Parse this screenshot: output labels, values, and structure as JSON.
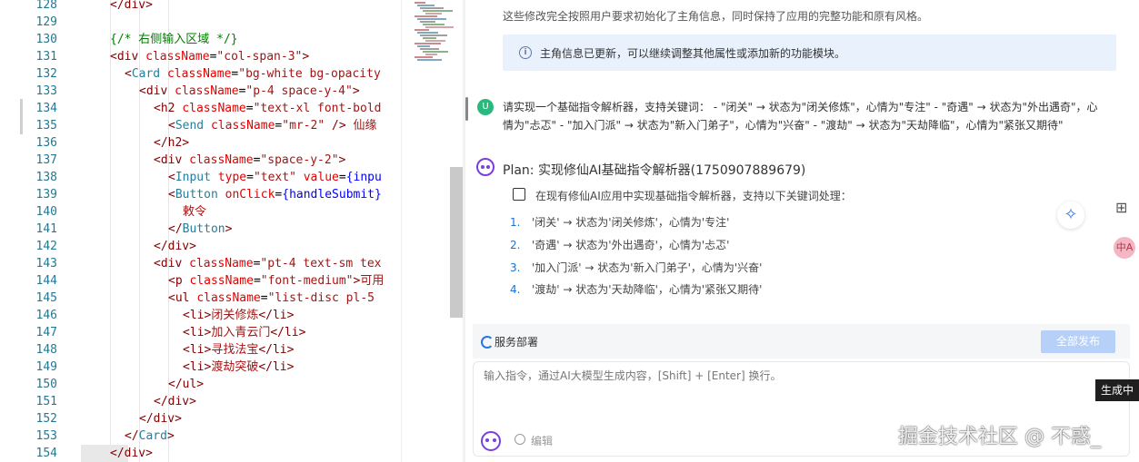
{
  "editor": {
    "lines": [
      {
        "n": "128",
        "indent": 4,
        "tokens": [
          [
            "t-tag",
            "</div>"
          ]
        ]
      },
      {
        "n": "129",
        "indent": 0,
        "tokens": []
      },
      {
        "n": "130",
        "indent": 4,
        "tokens": [
          [
            "t-com",
            "{/* 右侧输入区域 */}"
          ]
        ]
      },
      {
        "n": "131",
        "indent": 4,
        "tokens": [
          [
            "t-tag",
            "<div "
          ],
          [
            "t-attr",
            "className"
          ],
          [
            "t-txt",
            "="
          ],
          [
            "t-str",
            "\"col-span-3\""
          ],
          [
            "t-tag",
            ">"
          ]
        ]
      },
      {
        "n": "132",
        "indent": 6,
        "tokens": [
          [
            "t-tag",
            "<"
          ],
          [
            "t-comp",
            "Card"
          ],
          [
            "t-tag",
            " "
          ],
          [
            "t-attr",
            "className"
          ],
          [
            "t-txt",
            "="
          ],
          [
            "t-str",
            "\"bg-white bg-opacity"
          ]
        ]
      },
      {
        "n": "133",
        "indent": 8,
        "tokens": [
          [
            "t-tag",
            "<div "
          ],
          [
            "t-attr",
            "className"
          ],
          [
            "t-txt",
            "="
          ],
          [
            "t-str",
            "\"p-4 space-y-4\""
          ],
          [
            "t-tag",
            ">"
          ]
        ]
      },
      {
        "n": "134",
        "indent": 10,
        "tokens": [
          [
            "t-tag",
            "<h2 "
          ],
          [
            "t-attr",
            "className"
          ],
          [
            "t-txt",
            "="
          ],
          [
            "t-str",
            "\"text-xl font-bold"
          ]
        ]
      },
      {
        "n": "135",
        "indent": 12,
        "tokens": [
          [
            "t-tag",
            "<"
          ],
          [
            "t-comp",
            "Send"
          ],
          [
            "t-tag",
            " "
          ],
          [
            "t-attr",
            "className"
          ],
          [
            "t-txt",
            "="
          ],
          [
            "t-str",
            "\"mr-2\""
          ],
          [
            "t-tag",
            " /> "
          ],
          [
            "t-zh",
            "仙缘"
          ]
        ]
      },
      {
        "n": "136",
        "indent": 10,
        "tokens": [
          [
            "t-tag",
            "</h2>"
          ]
        ]
      },
      {
        "n": "137",
        "indent": 10,
        "tokens": [
          [
            "t-tag",
            "<div "
          ],
          [
            "t-attr",
            "className"
          ],
          [
            "t-txt",
            "="
          ],
          [
            "t-str",
            "\"space-y-2\""
          ],
          [
            "t-tag",
            ">"
          ]
        ]
      },
      {
        "n": "138",
        "indent": 12,
        "tokens": [
          [
            "t-tag",
            "<"
          ],
          [
            "t-comp",
            "Input"
          ],
          [
            "t-tag",
            " "
          ],
          [
            "t-attr",
            "type"
          ],
          [
            "t-txt",
            "="
          ],
          [
            "t-str",
            "\"text\""
          ],
          [
            "t-txt",
            " "
          ],
          [
            "t-attr",
            "value"
          ],
          [
            "t-txt",
            "="
          ],
          [
            "t-brace",
            "{inpu"
          ]
        ]
      },
      {
        "n": "139",
        "indent": 12,
        "tokens": [
          [
            "t-tag",
            "<"
          ],
          [
            "t-comp",
            "Button"
          ],
          [
            "t-tag",
            " "
          ],
          [
            "t-attr",
            "onClick"
          ],
          [
            "t-txt",
            "="
          ],
          [
            "t-brace",
            "{handleSubmit}"
          ]
        ]
      },
      {
        "n": "140",
        "indent": 14,
        "tokens": [
          [
            "t-zh",
            "敕令"
          ]
        ]
      },
      {
        "n": "141",
        "indent": 12,
        "tokens": [
          [
            "t-tag",
            "</"
          ],
          [
            "t-comp",
            "Button"
          ],
          [
            "t-tag",
            ">"
          ]
        ]
      },
      {
        "n": "142",
        "indent": 10,
        "tokens": [
          [
            "t-tag",
            "</div>"
          ]
        ]
      },
      {
        "n": "143",
        "indent": 10,
        "tokens": [
          [
            "t-tag",
            "<div "
          ],
          [
            "t-attr",
            "className"
          ],
          [
            "t-txt",
            "="
          ],
          [
            "t-str",
            "\"pt-4 text-sm tex"
          ]
        ]
      },
      {
        "n": "144",
        "indent": 12,
        "tokens": [
          [
            "t-tag",
            "<p "
          ],
          [
            "t-attr",
            "className"
          ],
          [
            "t-txt",
            "="
          ],
          [
            "t-str",
            "\"font-medium\""
          ],
          [
            "t-tag",
            ">"
          ],
          [
            "t-zh",
            "可用"
          ]
        ]
      },
      {
        "n": "145",
        "indent": 12,
        "tokens": [
          [
            "t-tag",
            "<ul "
          ],
          [
            "t-attr",
            "className"
          ],
          [
            "t-txt",
            "="
          ],
          [
            "t-str",
            "\"list-disc pl-5"
          ]
        ]
      },
      {
        "n": "146",
        "indent": 14,
        "tokens": [
          [
            "t-tag",
            "<li>"
          ],
          [
            "t-zh",
            "闭关修炼"
          ],
          [
            "t-tag",
            "</li>"
          ]
        ]
      },
      {
        "n": "147",
        "indent": 14,
        "tokens": [
          [
            "t-tag",
            "<li>"
          ],
          [
            "t-zh",
            "加入青云门"
          ],
          [
            "t-tag",
            "</li>"
          ]
        ]
      },
      {
        "n": "148",
        "indent": 14,
        "tokens": [
          [
            "t-tag",
            "<li>"
          ],
          [
            "t-zh",
            "寻找法宝"
          ],
          [
            "t-tag",
            "</li>"
          ]
        ]
      },
      {
        "n": "149",
        "indent": 14,
        "tokens": [
          [
            "t-tag",
            "<li>"
          ],
          [
            "t-zh",
            "渡劫突破"
          ],
          [
            "t-tag",
            "</li>"
          ]
        ]
      },
      {
        "n": "150",
        "indent": 12,
        "tokens": [
          [
            "t-tag",
            "</ul>"
          ]
        ]
      },
      {
        "n": "151",
        "indent": 10,
        "tokens": [
          [
            "t-tag",
            "</div>"
          ]
        ]
      },
      {
        "n": "152",
        "indent": 8,
        "tokens": [
          [
            "t-tag",
            "</div>"
          ]
        ]
      },
      {
        "n": "153",
        "indent": 6,
        "tokens": [
          [
            "t-tag",
            "</"
          ],
          [
            "t-comp",
            "Card"
          ],
          [
            "t-tag",
            ">"
          ]
        ]
      },
      {
        "n": "154",
        "indent": 4,
        "tokens": [
          [
            "t-tag",
            "</div>"
          ]
        ]
      }
    ]
  },
  "chat": {
    "intro": "这些修改完全按照用户要求初始化了主角信息，同时保持了应用的完整功能和原有风格。",
    "info": "主角信息已更新，可以继续调整其他属性或添加新的功能模块。",
    "info_icon": "i",
    "user_avatar": "U",
    "user_message": "请实现一个基础指令解析器，支持关键词： - \"闭关\" → 状态为\"闭关修炼\"，心情为\"专注\" - \"奇遇\" → 状态为\"外出遇奇\"，心情为\"忐忑\" - \"加入门派\" → 状态为\"新入门弟子\"，心情为\"兴奋\" - \"渡劫\" → 状态为\"天劫降临\"，心情为\"紧张又期待\"",
    "plan_title": "Plan: 实现修仙AI基础指令解析器(1750907889679)",
    "task": "在现有修仙AI应用中实现基础指令解析器，支持以下关键词处理：",
    "steps": [
      {
        "num": "1.",
        "text": "'闭关' → 状态为'闭关修炼'，心情为'专注'"
      },
      {
        "num": "2.",
        "text": "'奇遇' → 状态为'外出遇奇'，心情为'忐忑'"
      },
      {
        "num": "3.",
        "text": "'加入门派' → 状态为'新入门弟子'，心情为'兴奋'"
      },
      {
        "num": "4.",
        "text": "'渡劫' → 状态为'天劫降临'，心情为'紧张又期待'"
      }
    ],
    "deploy_label": "服务部署",
    "publish_label": "全部发布",
    "input_placeholder": "输入指令，通过AI大模型生成内容，[Shift] + [Enter] 换行。",
    "edit_label": "编辑",
    "float_logo": "✧",
    "grid_icon": "⊞",
    "translate_icon": "中A",
    "gen_badge": "生成中",
    "watermark": "掘金技术社区 @ 不惑_"
  },
  "colors": {
    "accent": "#2a74e8",
    "publish_disabled": "#b7d0f7",
    "brand_purple": "#7a3fdc",
    "user_green": "#2bb87c",
    "info_bg": "#e9f1fd"
  }
}
